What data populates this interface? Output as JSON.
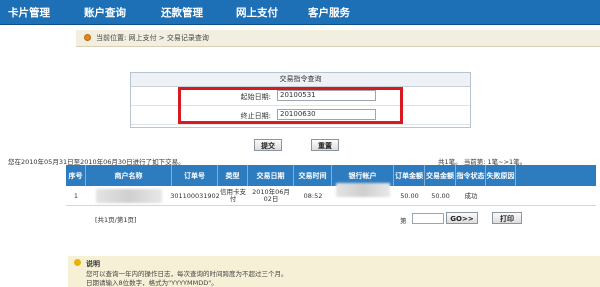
{
  "nav": {
    "items": [
      "卡片管理",
      "账户查询",
      "还款管理",
      "网上支付",
      "客户服务"
    ]
  },
  "breadcrumb": {
    "text": "当前位置: 网上支付 > 交易记录查询"
  },
  "query": {
    "title": "交易指令查询",
    "start_label": "起始日期:",
    "start_value": "20100531",
    "end_label": "终止日期:",
    "end_value": "20100630",
    "submit_label": "提交",
    "reset_label": "重置"
  },
  "summary": {
    "text": "您在2010年05月31日至2010年06月30日进行了如下交易。",
    "right": "共1笔。 当前第: 1笔~>1笔。"
  },
  "table": {
    "headers": [
      "序号",
      "商户名称",
      "订单号",
      "类型",
      "交易日期",
      "交易时间",
      "银行帐户",
      "订单金额",
      "交易金额",
      "指令状态",
      "失败原因"
    ],
    "rows": [
      {
        "seq": "1",
        "merchant": "",
        "order_no": "301100031902",
        "type": "信用卡支付",
        "date": "2010年06月02日",
        "time": "08:52",
        "account": "",
        "order_amt": "50.00",
        "txn_amt": "50.00",
        "status": "成功",
        "reason": ""
      }
    ]
  },
  "pager": {
    "text": "[共1页/第1页]",
    "page_label": "第",
    "page_value": "",
    "go_label": "GO>>",
    "print_label": "打印"
  },
  "notes": {
    "title": "说明",
    "lines": [
      "您可以查询一年内的操作日志，每次查询的时间跨度为不超过三个月。",
      "日期请输入8位数字，格式为\"YYYYMMDD\"。"
    ]
  },
  "colors": {
    "nav": "#1d6fb6",
    "table_header": "#2e7cc0",
    "highlight": "#d71920",
    "notes_bg": "#f6f1d6"
  }
}
